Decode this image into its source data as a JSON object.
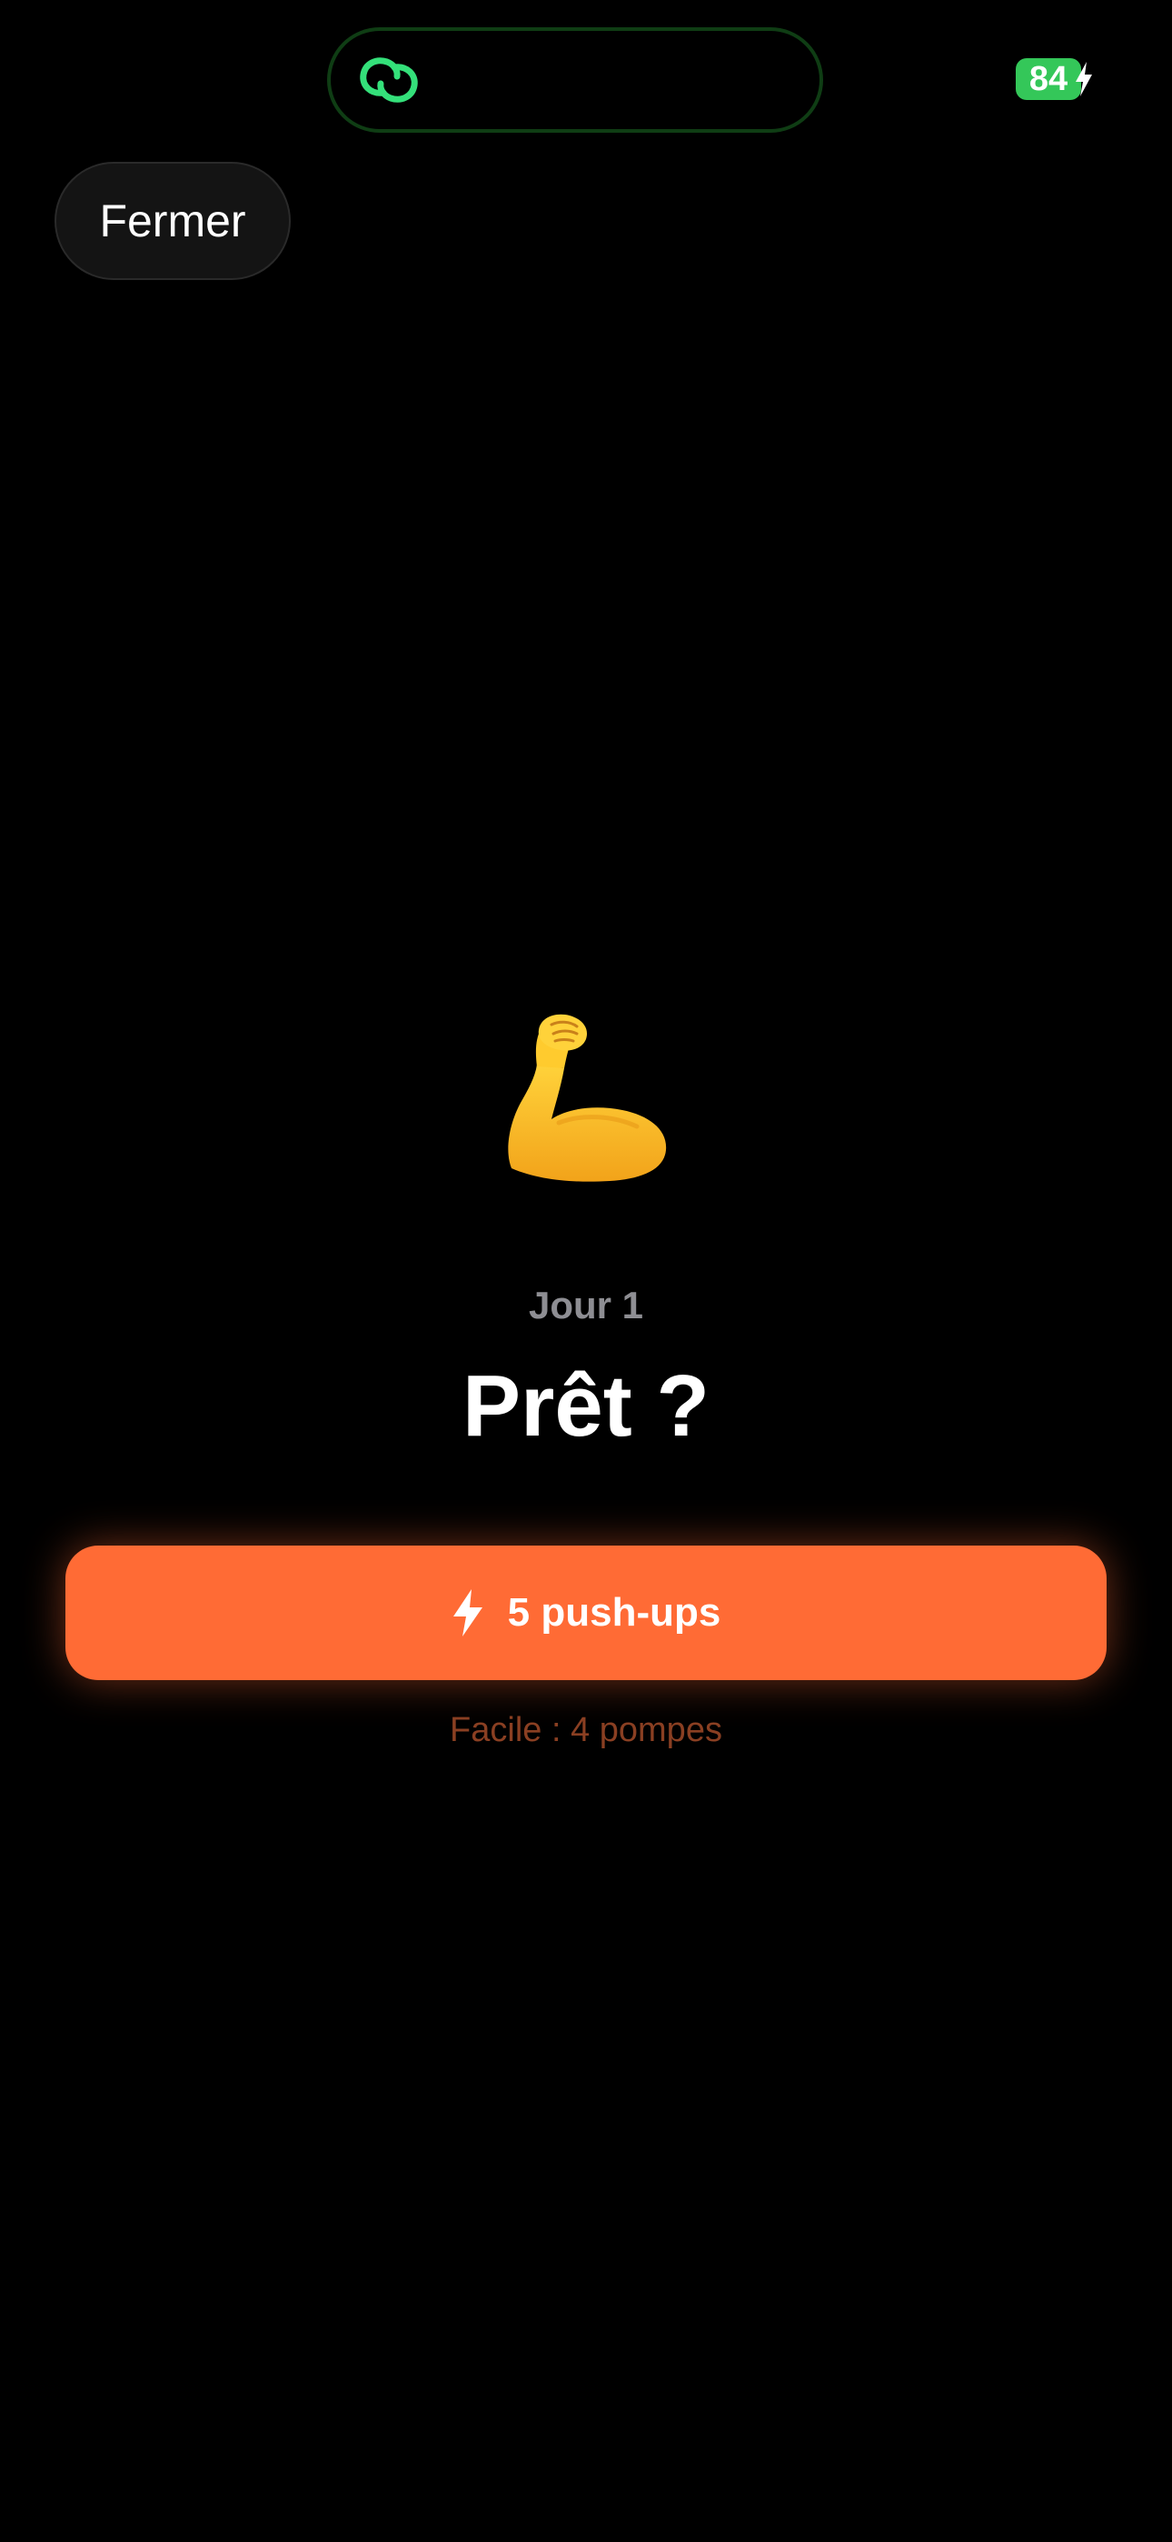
{
  "status_bar": {
    "island_icon": "link-rings-icon",
    "battery_level": "84",
    "battery_charging": true,
    "battery_color": "#34c759",
    "island_icon_color": "#34e07a"
  },
  "header": {
    "close_label": "Fermer"
  },
  "main": {
    "emoji": "flexed-biceps-icon",
    "day_label": "Jour 1",
    "title": "Prêt ?",
    "start_button": {
      "icon": "bolt-icon",
      "label": "5 push-ups",
      "color": "#ff6b35"
    },
    "easy_option_label": "Facile : 4 pompes"
  }
}
